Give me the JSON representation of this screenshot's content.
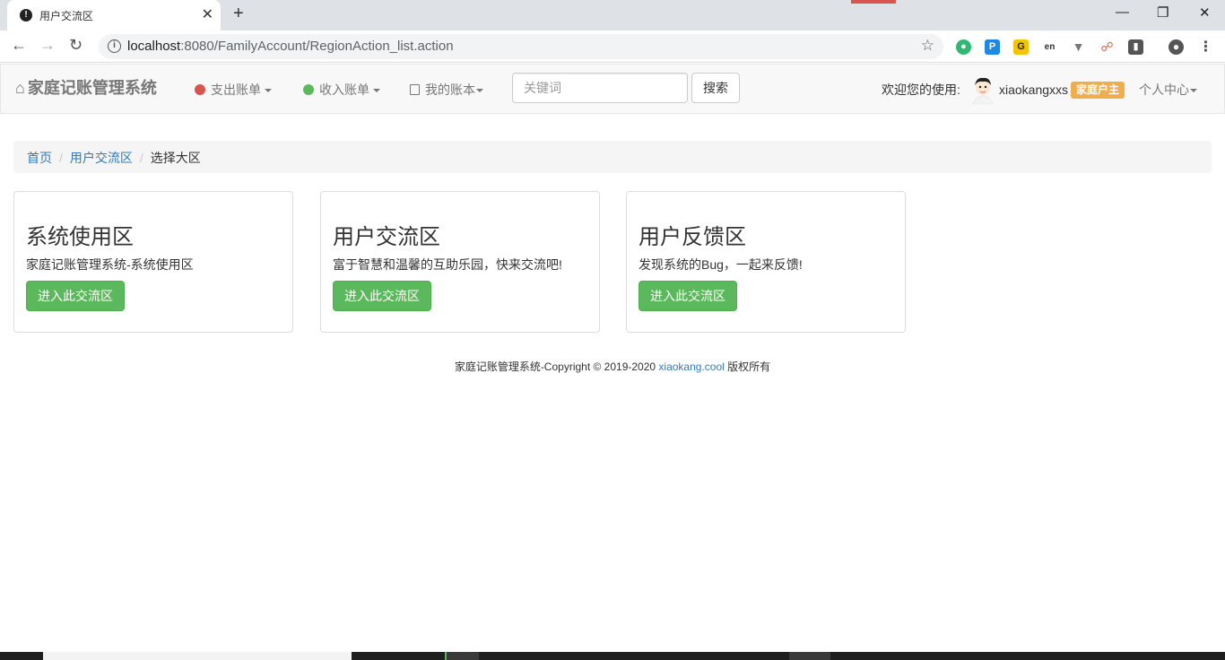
{
  "browser": {
    "tab_title": "用户交流区",
    "url_host": "localhost",
    "url_rest": ":8080/FamilyAccount/RegionAction_list.action"
  },
  "navbar": {
    "brand": "家庭记账管理系统",
    "expense_menu": "支出账单",
    "income_menu": "收入账单",
    "mybook_menu": "我的账本",
    "search_placeholder": "关键词",
    "search_button": "搜索",
    "welcome": "欢迎您的使用:",
    "username": "xiaokangxxs",
    "role_badge": "家庭户主",
    "personal_center": "个人中心"
  },
  "breadcrumb": {
    "items": [
      "首页",
      "用户交流区"
    ],
    "current": "选择大区"
  },
  "cards": [
    {
      "title": "系统使用区",
      "desc": "家庭记账管理系统-系统使用区",
      "button": "进入此交流区"
    },
    {
      "title": "用户交流区",
      "desc": "富于智慧和温馨的互助乐园，快来交流吧!",
      "button": "进入此交流区"
    },
    {
      "title": "用户反馈区",
      "desc": "发现系统的Bug，一起来反馈!",
      "button": "进入此交流区"
    }
  ],
  "footer": {
    "text": "家庭记账管理系统-Copyright © 2019-2020",
    "link": "xiaokang.cool",
    "suffix": "版权所有"
  },
  "colors": {
    "success": "#5cb85c",
    "link": "#337ab7",
    "warning": "#f0ad4e",
    "navbar_bg": "#f8f8f8"
  }
}
